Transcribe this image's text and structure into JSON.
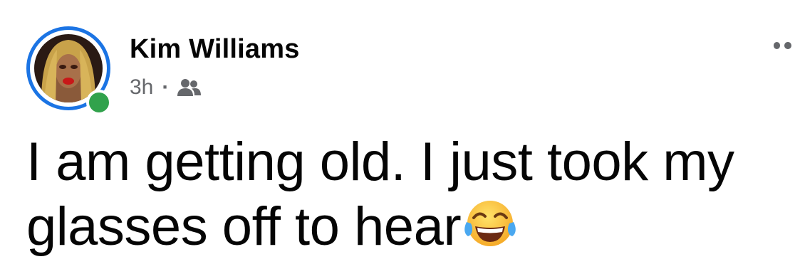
{
  "author": {
    "name": "Kim Williams",
    "online": true
  },
  "meta": {
    "time": "3h",
    "separator": "·",
    "audience_icon": "friends-icon"
  },
  "post": {
    "line1": "I am getting old. I just took my",
    "line2": "glasses off to hear",
    "emoji": "face-with-tears-of-joy-icon"
  },
  "colors": {
    "ring": "#1b74e4",
    "online": "#31a24c",
    "secondary_text": "#65676b",
    "primary_text": "#050505"
  }
}
